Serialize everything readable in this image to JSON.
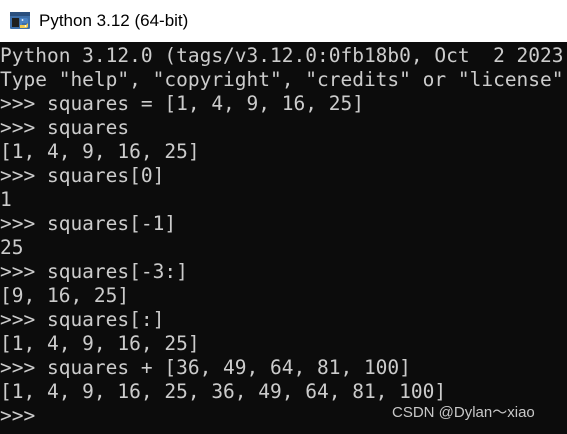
{
  "window": {
    "title": "Python 3.12 (64-bit)",
    "icon": "python-icon"
  },
  "console": {
    "lines": [
      "Python 3.12.0 (tags/v3.12.0:0fb18b0, Oct  2 2023",
      "Type \"help\", \"copyright\", \"credits\" or \"license\"",
      ">>> squares = [1, 4, 9, 16, 25]",
      ">>> squares",
      "[1, 4, 9, 16, 25]",
      ">>> squares[0]",
      "1",
      ">>> squares[-1]",
      "25",
      ">>> squares[-3:]",
      "[9, 16, 25]",
      ">>> squares[:]",
      "[1, 4, 9, 16, 25]",
      ">>> squares + [36, 49, 64, 81, 100]",
      "[1, 4, 9, 16, 25, 36, 49, 64, 81, 100]",
      ">>>"
    ],
    "text_color": "#cccccc",
    "background": "#0c0c0c"
  },
  "watermark": {
    "text": "CSDN @Dylan～xiao"
  }
}
